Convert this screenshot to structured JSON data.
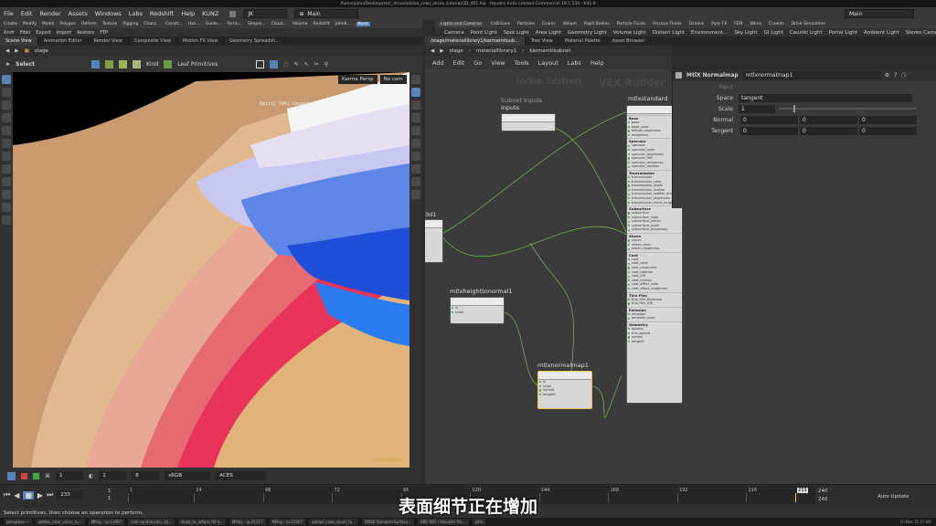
{
  "title_bar": "/home/john/Desktop/stor_drive/adidas_color_slices_tutorial/3D_001.hip - Houdini Indie Limited-Commercial 19.5.534 - Kit1.9",
  "menu": {
    "items": [
      "File",
      "Edit",
      "Render",
      "Assets",
      "Windows",
      "Labs",
      "Redshift",
      "Help",
      "KUNZ"
    ],
    "desktop_value": "JK",
    "main_label": "Main",
    "right_main_label": "Main"
  },
  "shelf_left": [
    "Create",
    "Modify",
    "Model",
    "Polygon",
    "Deform",
    "Texture",
    "Rigging",
    "Chara...",
    "Constr...",
    "Hair...",
    "Guide...",
    "Terrai...",
    "Simple...",
    "Cloud...",
    "Volume",
    "Redshift",
    "JohnK...",
    "Kunz"
  ],
  "shelf_right": [
    "Lights and Cameras",
    "Collisions",
    "Particles",
    "Grains",
    "Vellum",
    "Rigid Bodies",
    "Particle Fluids",
    "Viscous Fluids",
    "Oceans",
    "Pyro FX",
    "FEM",
    "Wires",
    "Crowds",
    "Drive Simulation"
  ],
  "shelf_left2": [
    "Rndr",
    "Fibki",
    "Export",
    "Import",
    "Restore",
    "FTP"
  ],
  "shelf_right2": [
    "Camera",
    "Point Light",
    "Spot Light",
    "Area Light",
    "Geometry Light",
    "Volume Light",
    "Distant Light",
    "Environment...",
    "Sky Light",
    "GI Light",
    "Caustic Light",
    "Portal Light",
    "Ambient Light",
    "Stereo Camera",
    "VR Came"
  ],
  "left_tabs": [
    "Scene View",
    "Animation Editor",
    "Render View",
    "Composite View",
    "Motion FX View",
    "Geometry Spreadsh..."
  ],
  "right_tabs": [
    "/stage/materiallibrary1/karmamtlsub...",
    "Tree View",
    "Material Palette",
    "Asset Browser"
  ],
  "viewer": {
    "path": "stage",
    "select_label": "Select",
    "kind_label": "Kind",
    "leaf_label": "Leaf Primitives",
    "camera_label": "Karma Persp",
    "cam_label": "No cam",
    "optix_text": "Optix[ 54%] Caustics...",
    "edition_label": "Indie Edition",
    "bottom_val1": "1",
    "bottom_val2": "1",
    "bottom_val3": "8",
    "colorspace": "sRGB",
    "tonemap": "ACES"
  },
  "network": {
    "path_items": [
      "stage",
      "materiallibrary1",
      "karmamtlsubnet"
    ],
    "menu": [
      "Add",
      "Edit",
      "Go",
      "View",
      "Tools",
      "Layout",
      "Labs",
      "Help"
    ],
    "watermark": "Indie Edition",
    "builder": "VEX Builder",
    "nodes": {
      "subnet_title": "Subnet Inputs",
      "inputs": "inputs",
      "mtlxstandard": "mtlxstandard",
      "d1": "3d1",
      "heighttonormal": "mtlxheighttonormal1",
      "normalmap": "mtlxnormalmap1"
    },
    "height_ports": [
      "in",
      "scale"
    ],
    "height_out": "out",
    "normal_ports": [
      "in",
      "scale",
      "normal",
      "tangent"
    ],
    "normal_out": "out",
    "std_sections": [
      {
        "name": "Base",
        "ports": [
          "base",
          "base_color",
          "diffuse_roughness",
          "metalness"
        ]
      },
      {
        "name": "Specular",
        "ports": [
          "specular",
          "specular_color",
          "specular_roughness",
          "specular_IOR",
          "specular_anisotropy",
          "specular_rotation"
        ]
      },
      {
        "name": "Transmission",
        "ports": [
          "transmission",
          "transmission_color",
          "transmission_depth",
          "transmission_scatter",
          "transmission_scatter_aniso...",
          "transmission_dispersion",
          "transmission_extra_roughn..."
        ]
      },
      {
        "name": "Subsurface",
        "ports": [
          "subsurface",
          "subsurface_color",
          "subsurface_radius",
          "subsurface_scale",
          "subsurface_anisotropy"
        ]
      },
      {
        "name": "Sheen",
        "ports": [
          "sheen",
          "sheen_color",
          "sheen_roughness"
        ]
      },
      {
        "name": "Coat",
        "ports": [
          "coat",
          "coat_color",
          "coat_roughness",
          "coat_rotation",
          "coat_IOR",
          "coat_normal",
          "coat_affect_color",
          "coat_affect_roughness"
        ]
      },
      {
        "name": "Thin Film",
        "ports": [
          "thin_film_thickness",
          "thin_film_IOR"
        ]
      },
      {
        "name": "Emission",
        "ports": [
          "emission",
          "emission_color"
        ]
      },
      {
        "name": "Geometry",
        "ports": [
          "opacity",
          "thin_walled",
          "normal",
          "tangent"
        ]
      }
    ]
  },
  "params": {
    "node_type": "MtlX Normalmap",
    "node_name": "mtlxnormalmap1",
    "input_label": "Input",
    "space_label": "Space",
    "space_value": "tangent",
    "scale_label": "Scale",
    "scale_value": "1",
    "normal_label": "Normal",
    "normal_values": [
      "0",
      "0",
      "0"
    ],
    "tangent_label": "Tangent",
    "tangent_values": [
      "0",
      "0",
      "0"
    ]
  },
  "timeline": {
    "current_frame": "233",
    "start1": "1",
    "start2": "1",
    "ticks": [
      "1",
      "24",
      "48",
      "72",
      "96",
      "120",
      "144",
      "168",
      "192",
      "216",
      "233"
    ],
    "end1": "240",
    "end2": "240",
    "auto_update": "Auto Update"
  },
  "status_text": "Select primitives, then choose an operation to perform.",
  "taskbar": [
    "john@box:~",
    "adidas_color_slices_tu...",
    "MPlay - ip-11067",
    "cool.sundial john_10...",
    "shots_to_inflate_04.h...",
    "MPlay - ip-21217",
    "MPlay - ip-21567",
    "adidas_color_slices_tu...",
    "DNSE Standard Surface...",
    "BBC REC I (Houdini Pro...",
    "john"
  ],
  "taskbar_time": "Fri Dec 15 17:00",
  "subtitle": "表面细节正在增加",
  "colors": {
    "accent": "#f0c04a",
    "selected_node": "#e8c34a",
    "wire": "#6fb04a"
  }
}
